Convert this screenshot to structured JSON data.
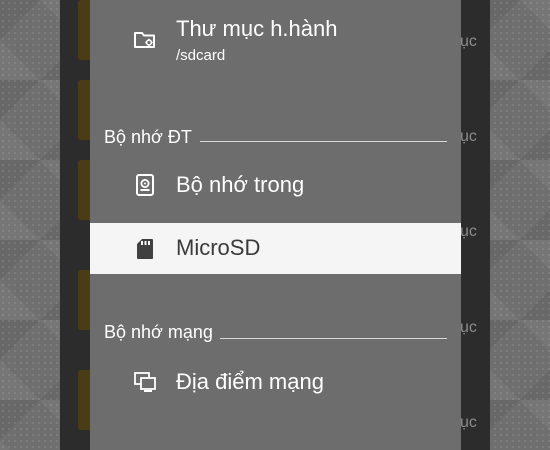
{
  "dialog": {
    "current_folder": {
      "label": "Thư mục h.hành",
      "path": "/sdcard",
      "icon": "folder-settings-icon"
    },
    "sections": [
      {
        "title": "Bộ nhớ ĐT",
        "items": [
          {
            "label": "Bộ nhớ trong",
            "icon": "phone-storage-icon"
          },
          {
            "label": "MicroSD",
            "icon": "sd-card-icon",
            "selected": true
          }
        ]
      },
      {
        "title": "Bộ nhớ mạng",
        "items": [
          {
            "label": "Địa điểm mạng",
            "icon": "network-computer-icon"
          }
        ]
      }
    ]
  },
  "background": {
    "row_text_fragment": "ục"
  },
  "colors": {
    "dialog_bg": "#6d6d6d",
    "selected_bg": "#f5f5f5",
    "text": "#ffffff",
    "selected_text": "#3a3a3a",
    "background_icon": "#4a3d15"
  }
}
